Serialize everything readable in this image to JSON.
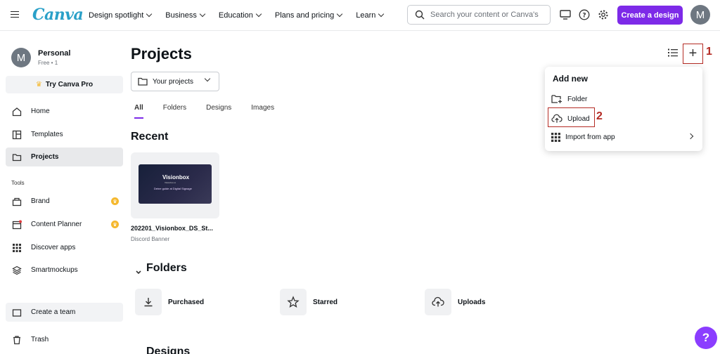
{
  "brand": {
    "logo_text": "Canva",
    "accent": "#7d2ae8",
    "annotation_color": "#b42b24"
  },
  "nav": {
    "items": [
      "Design spotlight",
      "Business",
      "Education",
      "Plans and pricing",
      "Learn"
    ]
  },
  "search": {
    "placeholder": "Search your content or Canva's"
  },
  "header": {
    "create_label": "Create a design",
    "avatar_initial": "M"
  },
  "sidebar": {
    "profile": {
      "initial": "M",
      "name": "Personal",
      "plan": "Free • 1"
    },
    "try_pro": "Try Canva Pro",
    "items": [
      {
        "label": "Home",
        "icon": "home-icon"
      },
      {
        "label": "Templates",
        "icon": "templates-icon"
      },
      {
        "label": "Projects",
        "icon": "folder-icon"
      }
    ],
    "tools_label": "Tools",
    "tools": [
      {
        "label": "Brand",
        "icon": "brand-icon"
      },
      {
        "label": "Content Planner",
        "icon": "calendar-icon"
      },
      {
        "label": "Discover apps",
        "icon": "apps-grid-icon"
      },
      {
        "label": "Smartmockups",
        "icon": "smartmockups-icon"
      }
    ],
    "create_team": "Create a team",
    "trash": "Trash"
  },
  "main": {
    "title": "Projects",
    "filter_select": "Your projects",
    "tabs": [
      "All",
      "Folders",
      "Designs",
      "Images"
    ],
    "recent_title": "Recent",
    "design": {
      "name": "202201_Visionbox_DS_St...",
      "type": "Discord Banner",
      "thumb_title": "Visionbox",
      "thumb_sub": "Visionbox.io",
      "thumb_tagline": "Deine guide at Digital Signage"
    },
    "folders_title": "Folders",
    "folders": [
      "Purchased",
      "Starred",
      "Uploads"
    ],
    "designs_title": "Designs"
  },
  "dropdown": {
    "title": "Add new",
    "items": [
      "Folder",
      "Upload",
      "Import from app"
    ]
  },
  "annotations": {
    "step1": "1",
    "step2": "2"
  },
  "help": "?"
}
